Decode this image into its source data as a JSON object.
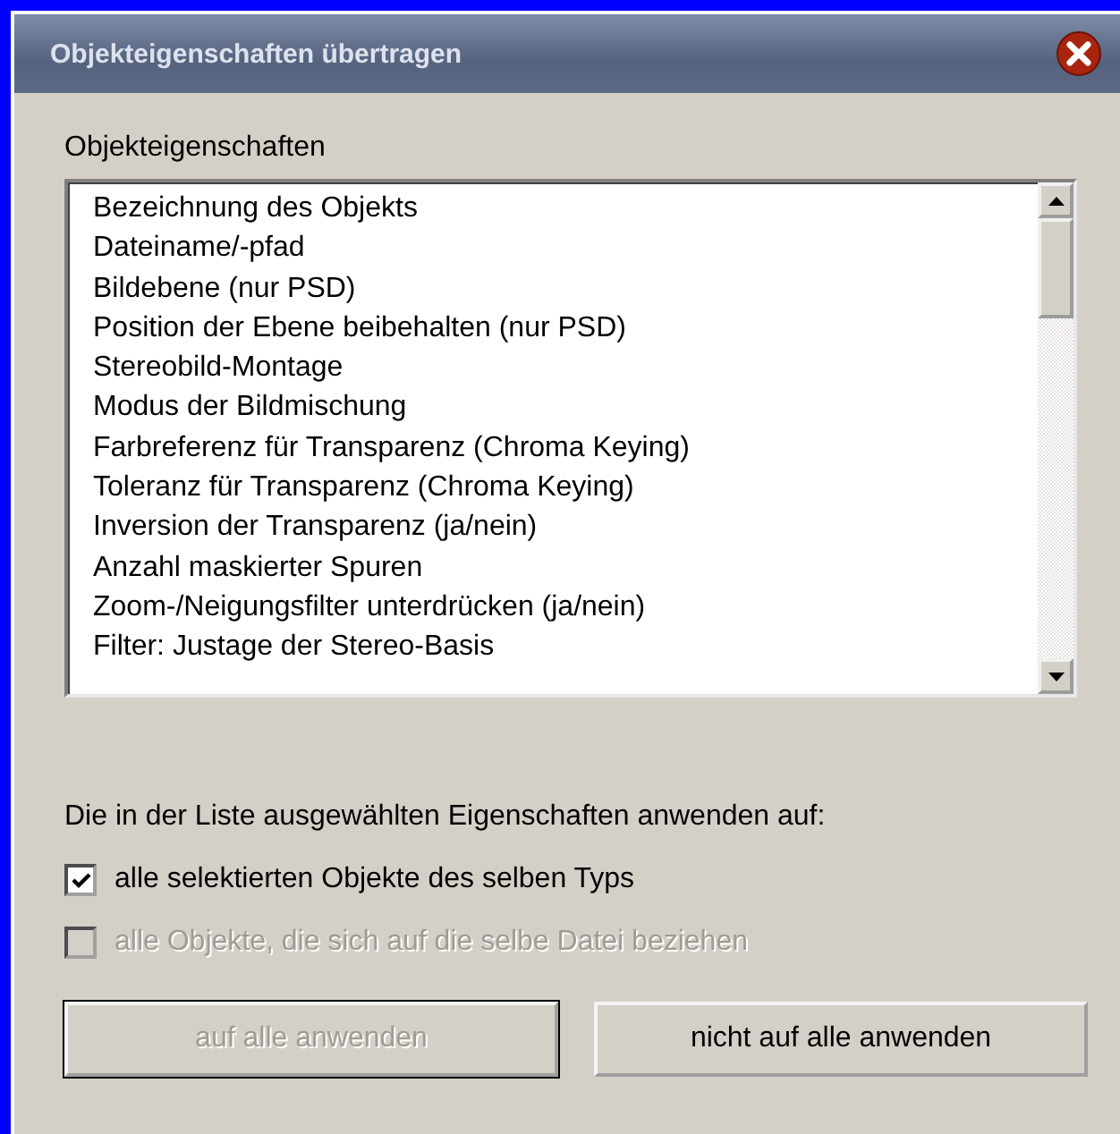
{
  "window": {
    "title": "Objekteigenschaften übertragen"
  },
  "list_label": "Objekteigenschaften",
  "properties": [
    {
      "label": "Bezeichnung des Objekts",
      "selected": false
    },
    {
      "label": "Dateiname/-pfad",
      "selected": false
    },
    {
      "label": "Bildebene (nur PSD)",
      "selected": false
    },
    {
      "label": "Position der Ebene beibehalten (nur PSD)",
      "selected": false
    },
    {
      "label": "Stereobild-Montage",
      "selected": false
    },
    {
      "label": "Modus der Bildmischung",
      "selected": false
    },
    {
      "label": "Farbreferenz für Transparenz (Chroma Keying)",
      "selected": false
    },
    {
      "label": "Toleranz für Transparenz (Chroma Keying)",
      "selected": false
    },
    {
      "label": "Inversion der Transparenz (ja/nein)",
      "selected": false
    },
    {
      "label": "Anzahl maskierter Spuren",
      "selected": false
    },
    {
      "label": "Zoom-/Neigungsfilter unterdrücken (ja/nein)",
      "selected": false
    },
    {
      "label": "Filter: Justage der Stereo-Basis",
      "selected": false
    }
  ],
  "apply_label": "Die in der Liste ausgewählten Eigenschaften anwenden auf:",
  "options": [
    {
      "label": "alle selektierten Objekte des selben Typs",
      "checked": true,
      "disabled": false
    },
    {
      "label": "alle Objekte, die sich auf die selbe Datei beziehen",
      "checked": false,
      "disabled": true
    }
  ],
  "buttons": [
    {
      "label": "auf alle anwenden",
      "disabled": true,
      "default": true
    },
    {
      "label": "nicht auf alle anwenden",
      "disabled": false,
      "default": false
    }
  ]
}
